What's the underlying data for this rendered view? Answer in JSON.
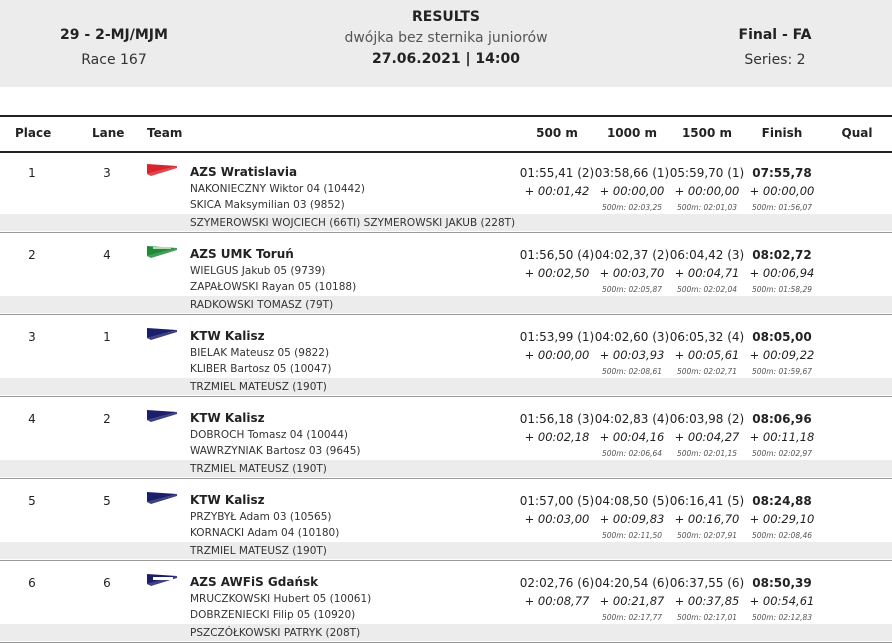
{
  "header": {
    "event_code": "29 - 2-MJ/MJM",
    "race": "Race 167",
    "title": "RESULTS",
    "subtitle": "dwójka bez sternika juniorów",
    "datetime": "27.06.2021 | 14:00",
    "final": "Final - FA",
    "series": "Series: 2"
  },
  "columns": {
    "place": "Place",
    "lane": "Lane",
    "team": "Team",
    "m500": "500 m",
    "m1000": "1000 m",
    "m1500": "1500 m",
    "finish": "Finish",
    "qual": "Qual"
  },
  "rows": [
    {
      "place": "1",
      "lane": "3",
      "team": "AZS Wratislavia",
      "flag": {
        "color": "#d9232e",
        "style": "red"
      },
      "athletes": [
        "NAKONIECZNY  Wiktor 04 (10442)",
        "SKICA  Maksymilian 03 (9852)"
      ],
      "coach": "SZYMEROWSKI WOJCIECH (66TI) SZYMEROWSKI JAKUB (228T)",
      "s500": {
        "time": "01:55,41 (2)",
        "diff": "+ 00:01,42"
      },
      "s1000": {
        "time": "03:58,66 (1)",
        "diff": "+ 00:00,00",
        "pace": "500m: 02:03,25"
      },
      "s1500": {
        "time": "05:59,70 (1)",
        "diff": "+ 00:00,00",
        "pace": "500m: 02:01,03"
      },
      "finish": {
        "time": "07:55,78",
        "diff": "+ 00:00,00",
        "pace": "500m: 01:56,07"
      }
    },
    {
      "place": "2",
      "lane": "4",
      "team": "AZS UMK Toruń",
      "flag": {
        "color": "#1f8b3a",
        "style": "green"
      },
      "athletes": [
        "WIELGUS  Jakub 05 (9739)",
        "ZAPAŁOWSKI  Rayan 05 (10188)"
      ],
      "coach": "RADKOWSKI TOMASZ (79T)",
      "s500": {
        "time": "01:56,50 (4)",
        "diff": "+ 00:02,50"
      },
      "s1000": {
        "time": "04:02,37 (2)",
        "diff": "+ 00:03,70",
        "pace": "500m: 02:05,87"
      },
      "s1500": {
        "time": "06:04,42 (3)",
        "diff": "+ 00:04,71",
        "pace": "500m: 02:02,04"
      },
      "finish": {
        "time": "08:02,72",
        "diff": "+ 00:06,94",
        "pace": "500m: 01:58,29"
      }
    },
    {
      "place": "3",
      "lane": "1",
      "team": "KTW Kalisz",
      "flag": {
        "color": "#1b1f6b",
        "style": "navy"
      },
      "athletes": [
        "BIELAK  Mateusz 05 (9822)",
        "KLIBER  Bartosz 05 (10047)"
      ],
      "coach": "TRZMIEL MATEUSZ (190T)",
      "s500": {
        "time": "01:53,99 (1)",
        "diff": "+ 00:00,00"
      },
      "s1000": {
        "time": "04:02,60 (3)",
        "diff": "+ 00:03,93",
        "pace": "500m: 02:08,61"
      },
      "s1500": {
        "time": "06:05,32 (4)",
        "diff": "+ 00:05,61",
        "pace": "500m: 02:02,71"
      },
      "finish": {
        "time": "08:05,00",
        "diff": "+ 00:09,22",
        "pace": "500m: 01:59,67"
      }
    },
    {
      "place": "4",
      "lane": "2",
      "team": "KTW Kalisz",
      "flag": {
        "color": "#1b1f6b",
        "style": "navy"
      },
      "athletes": [
        "DOBROCH  Tomasz 04 (10044)",
        "WAWRZYNIAK  Bartosz 03 (9645)"
      ],
      "coach": "TRZMIEL MATEUSZ (190T)",
      "s500": {
        "time": "01:56,18 (3)",
        "diff": "+ 00:02,18"
      },
      "s1000": {
        "time": "04:02,83 (4)",
        "diff": "+ 00:04,16",
        "pace": "500m: 02:06,64"
      },
      "s1500": {
        "time": "06:03,98 (2)",
        "diff": "+ 00:04,27",
        "pace": "500m: 02:01,15"
      },
      "finish": {
        "time": "08:06,96",
        "diff": "+ 00:11,18",
        "pace": "500m: 02:02,97"
      }
    },
    {
      "place": "5",
      "lane": "5",
      "team": "KTW Kalisz",
      "flag": {
        "color": "#1b1f6b",
        "style": "navy"
      },
      "athletes": [
        "PRZYBYŁ  Adam 03 (10565)",
        "KORNACKI  Adam 04 (10180)"
      ],
      "coach": "TRZMIEL MATEUSZ (190T)",
      "s500": {
        "time": "01:57,00 (5)",
        "diff": "+ 00:03,00"
      },
      "s1000": {
        "time": "04:08,50 (5)",
        "diff": "+ 00:09,83",
        "pace": "500m: 02:11,50"
      },
      "s1500": {
        "time": "06:16,41 (5)",
        "diff": "+ 00:16,70",
        "pace": "500m: 02:07,91"
      },
      "finish": {
        "time": "08:24,88",
        "diff": "+ 00:29,10",
        "pace": "500m: 02:08,46"
      }
    },
    {
      "place": "6",
      "lane": "6",
      "team": "AZS AWFiS Gdańsk",
      "flag": {
        "color": "#1b1f6b",
        "style": "navy-white"
      },
      "athletes": [
        "MRUCZKOWSKI  Hubert 05 (10061)",
        "DOBRZENIECKI  Filip 05 (10920)"
      ],
      "coach": "PSZCZÓŁKOWSKI PATRYK (208T)",
      "s500": {
        "time": "02:02,76 (6)",
        "diff": "+ 00:08,77"
      },
      "s1000": {
        "time": "04:20,54 (6)",
        "diff": "+ 00:21,87",
        "pace": "500m: 02:17,77"
      },
      "s1500": {
        "time": "06:37,55 (6)",
        "diff": "+ 00:37,85",
        "pace": "500m: 02:17,01"
      },
      "finish": {
        "time": "08:50,39",
        "diff": "+ 00:54,61",
        "pace": "500m: 02:12,83"
      }
    }
  ]
}
